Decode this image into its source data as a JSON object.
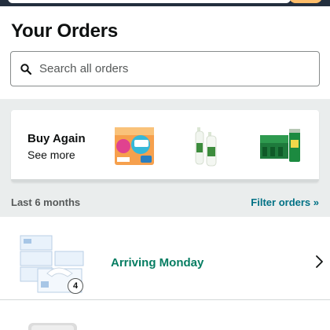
{
  "page": {
    "title": "Your Orders"
  },
  "search": {
    "placeholder": "Search all orders"
  },
  "buy_again": {
    "title": "Buy Again",
    "see_more": "See more",
    "products": [
      {
        "icon": "diaper-pack-thumbnail"
      },
      {
        "icon": "water-bottles-thumbnail"
      },
      {
        "icon": "sparkling-water-cans-thumbnail"
      }
    ]
  },
  "filter": {
    "range_label": "Last 6 months",
    "link_label": "Filter orders »"
  },
  "orders": [
    {
      "status": "Arriving Monday",
      "quantity": "4",
      "icon": "tissue-box-thumbnail"
    }
  ],
  "colors": {
    "header_dark": "#232f3e",
    "accent_orange": "#febd69",
    "link_teal": "#007185",
    "status_green": "#067d62",
    "band_gray": "#eaeded"
  }
}
